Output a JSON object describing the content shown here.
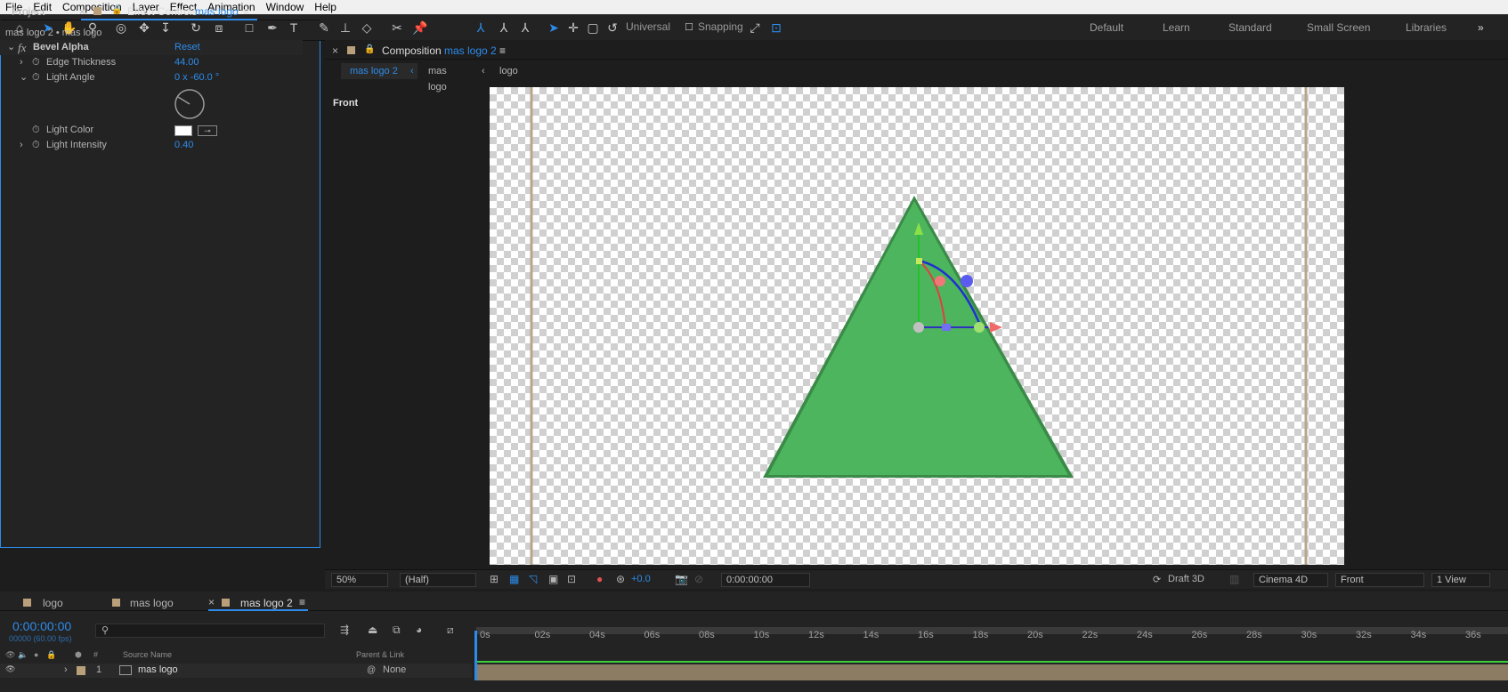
{
  "menu": [
    "File",
    "Edit",
    "Composition",
    "Layer",
    "Effect",
    "Animation",
    "Window",
    "Help"
  ],
  "toolbar": {
    "universal": "Universal",
    "snapping": "Snapping"
  },
  "workspaces": [
    "Default",
    "Learn",
    "Standard",
    "Small Screen",
    "Libraries"
  ],
  "left": {
    "tab_project": "Project",
    "tab_effect": "Effect Controls",
    "tab_effect_layer": "mas logo",
    "breadcrumb": "mas logo 2 • mas logo",
    "effect_name": "Bevel Alpha",
    "reset": "Reset",
    "props": [
      {
        "label": "Edge Thickness",
        "value": "44.00"
      },
      {
        "label": "Light Angle",
        "value": "0 x -60.0 °"
      },
      {
        "label": "Light Color",
        "value": ""
      },
      {
        "label": "Light Intensity",
        "value": "0.40"
      }
    ]
  },
  "comp": {
    "tab_label": "Composition",
    "tab_name": "mas logo 2",
    "crumbs": [
      "mas logo 2",
      "mas logo",
      "logo"
    ],
    "view_label": "Front"
  },
  "viewerbar": {
    "zoom": "50%",
    "resolution": "(Half)",
    "exposure": "+0.0",
    "timecode": "0:00:00:00",
    "renderer_draft": "Draft 3D",
    "renderer": "Cinema 4D",
    "view": "Front",
    "layout": "1 View"
  },
  "timeline": {
    "tabs": [
      "logo",
      "mas logo",
      "mas logo 2"
    ],
    "timecode": "0:00:00:00",
    "fps": "00000 (60.00 fps)",
    "headers": {
      "hash": "#",
      "source": "Source Name",
      "parent": "Parent & Link"
    },
    "layer": {
      "num": "1",
      "name": "mas logo",
      "parent": "None"
    },
    "ruler": [
      "0s",
      "02s",
      "04s",
      "06s",
      "08s",
      "10s",
      "12s",
      "14s",
      "16s",
      "18s",
      "20s",
      "22s",
      "24s",
      "26s",
      "28s",
      "30s",
      "32s",
      "34s",
      "36s"
    ]
  },
  "colors": {
    "accent": "#2d8ceb",
    "triangle": "#4db55d",
    "bg": "#232323"
  }
}
